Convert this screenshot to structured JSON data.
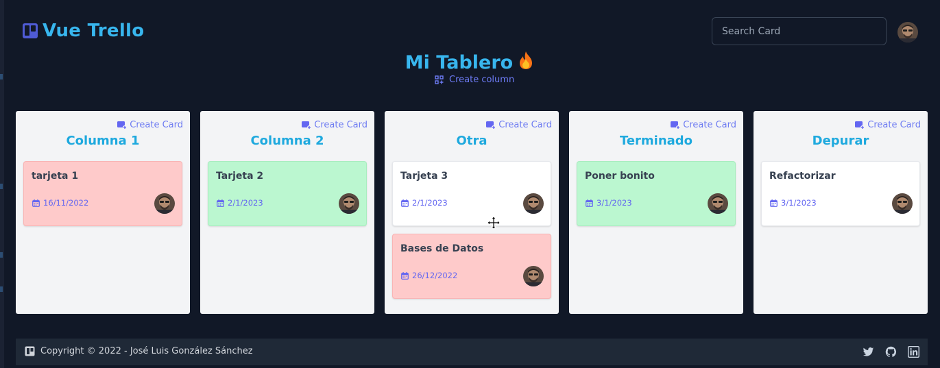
{
  "app": {
    "title": "Vue Trello"
  },
  "search": {
    "placeholder": "Search Card",
    "value": ""
  },
  "board": {
    "title": "Mi Tablero",
    "emoji": "🔥",
    "create_column_label": "Create column"
  },
  "columns": [
    {
      "title": "Columna 1",
      "create_label": "Create Card",
      "cards": [
        {
          "title": "tarjeta 1",
          "date": "16/11/2022",
          "color": "red"
        }
      ]
    },
    {
      "title": "Columna 2",
      "create_label": "Create Card",
      "cards": [
        {
          "title": "Tarjeta 2",
          "date": "2/1/2023",
          "color": "green"
        }
      ]
    },
    {
      "title": "Otra",
      "create_label": "Create Card",
      "cards": [
        {
          "title": "Tarjeta 3",
          "date": "2/1/2023",
          "color": "white"
        },
        {
          "title": "Bases de Datos",
          "date": "26/12/2022",
          "color": "red"
        }
      ]
    },
    {
      "title": "Terminado",
      "create_label": "Create Card",
      "cards": [
        {
          "title": "Poner bonito",
          "date": "3/1/2023",
          "color": "green"
        }
      ]
    },
    {
      "title": "Depurar",
      "create_label": "Create Card",
      "cards": [
        {
          "title": "Refactorizar",
          "date": "3/1/2023",
          "color": "white"
        }
      ]
    }
  ],
  "footer": {
    "copyright": "Copyright © 2022 - José Luis González Sánchez",
    "social": [
      "twitter-icon",
      "github-icon",
      "linkedin-icon"
    ]
  },
  "colors": {
    "background": "#111827",
    "accent": "#38b6ee",
    "link": "#6366f1",
    "card_red": "#fecaca",
    "card_green": "#bbf7d0",
    "column_bg": "#f3f4f6",
    "footer_bg": "#1f2937"
  }
}
